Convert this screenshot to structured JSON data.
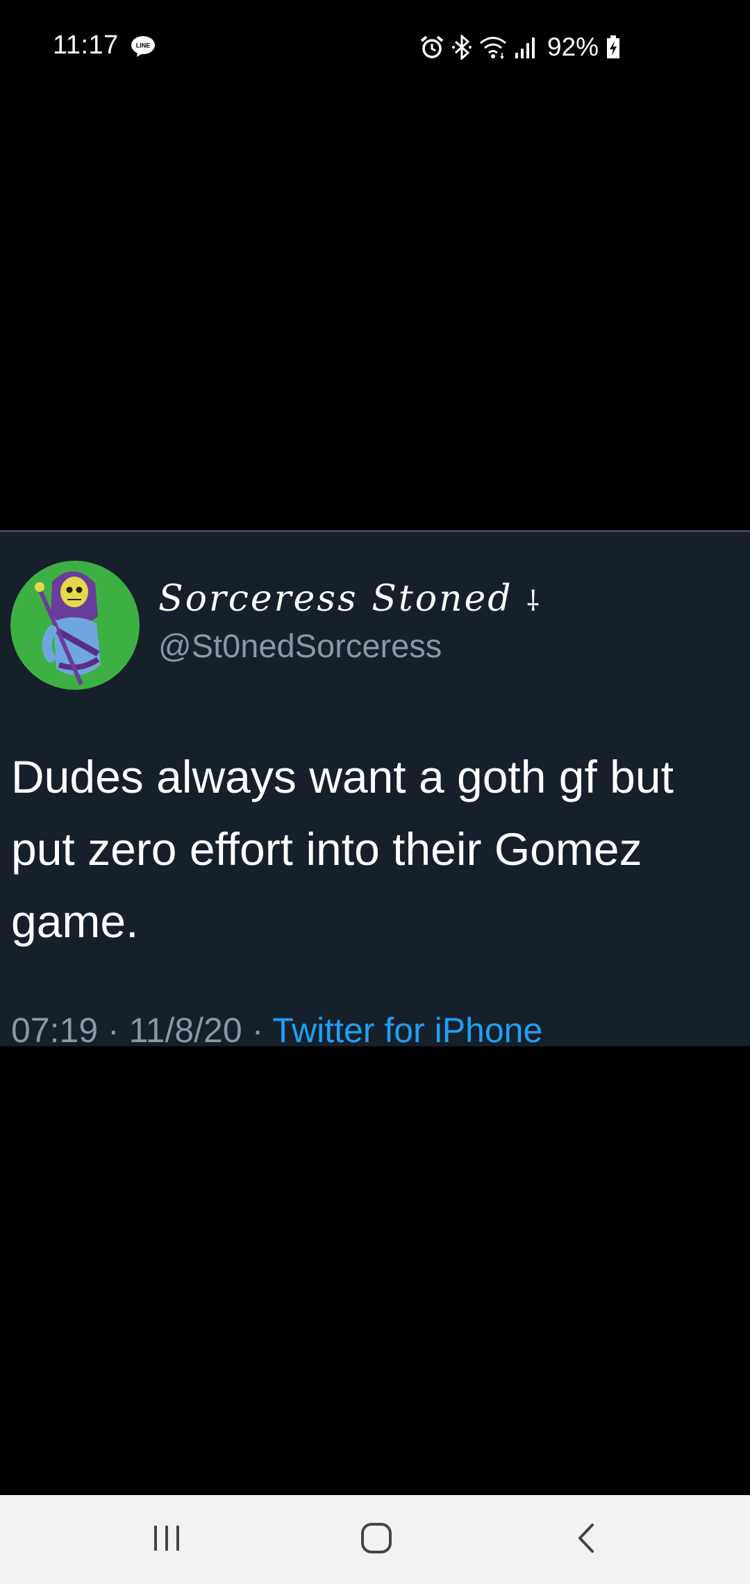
{
  "status_bar": {
    "time": "11:17",
    "battery": "92%",
    "icons": [
      "line-icon",
      "alarm-icon",
      "bluetooth-icon",
      "wifi-icon",
      "signal-icon",
      "battery-charging-icon"
    ]
  },
  "tweet": {
    "display_name": "Sorceress Stoned",
    "display_name_symbol": "⸸",
    "handle": "@St0nedSorceress",
    "text": "Dudes always want a goth gf but put zero effort into their Gomez game.",
    "time": "07:19",
    "date": "11/8/20",
    "separator": " · ",
    "source": "Twitter for iPhone"
  },
  "nav_bar": {
    "buttons": [
      "recent-apps-icon",
      "home-icon",
      "back-icon"
    ]
  },
  "colors": {
    "card_background": "#15202b",
    "secondary_text": "#8899a6",
    "link": "#1da1f2",
    "avatar_background": "#3cb043",
    "nav_background": "#f2f2f2"
  }
}
